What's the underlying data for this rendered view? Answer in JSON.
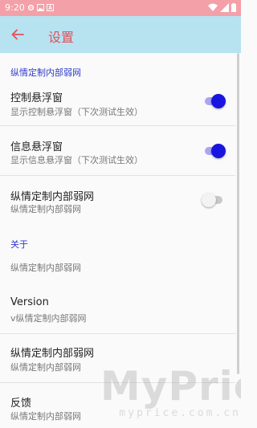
{
  "status_bar": {
    "time": "9:20",
    "icons": [
      "settings-icon",
      "image-icon",
      "a-icon",
      "wifi-icon",
      "signal-icon",
      "battery-icon"
    ]
  },
  "toolbar": {
    "title": "设置",
    "back_icon": "arrow-left-icon"
  },
  "categories": {
    "first": "纵情定制内部弱网",
    "about": "关于"
  },
  "prefs": {
    "control_float": {
      "title": "控制悬浮窗",
      "summary": "显示控制悬浮窗（下次测试生效）",
      "enabled": true
    },
    "info_float": {
      "title": "信息悬浮窗",
      "summary": "显示信息悬浮窗（下次测试生效）",
      "enabled": true
    },
    "weak_net": {
      "title": "纵情定制内部弱网",
      "summary": "纵情定制内部弱网",
      "enabled": false
    },
    "about_desc": {
      "summary": "纵情定制内部弱网"
    },
    "version": {
      "title": "Version",
      "summary": "v纵情定制内部弱网"
    },
    "app_name": {
      "title": "纵情定制内部弱网",
      "summary": "纵情定制内部弱网"
    },
    "feedback": {
      "title": "反馈",
      "summary": "纵情定制内部弱网"
    }
  },
  "watermark": {
    "big": "MyPrice",
    "small": "myprice.com.cn"
  },
  "colors": {
    "status_bar": "#F4A0A8",
    "toolbar": "#B7E2F0",
    "title": "#E0515B",
    "category": "#2F3AC9",
    "switch_on": "#1A14E0"
  }
}
